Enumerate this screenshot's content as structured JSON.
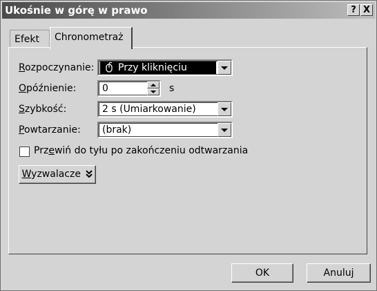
{
  "window": {
    "title": "Ukośnie w górę w prawo",
    "help_label": "?",
    "close_label": "X"
  },
  "tabs": [
    {
      "label": "Efekt"
    },
    {
      "label": "Chronometraż"
    }
  ],
  "fields": {
    "start": {
      "label_u": "R",
      "label_rest": "ozpoczynanie:",
      "value": "Przy kliknięciu",
      "icon": "mouse-icon"
    },
    "delay": {
      "label_u": "O",
      "label_rest": "późnienie:",
      "value": "0",
      "unit": "s"
    },
    "speed": {
      "label_u": "S",
      "label_rest": "zybkość:",
      "value": "2 s (Umiarkowanie)"
    },
    "repeat": {
      "label_u": "P",
      "label_rest": "owtarzanie:",
      "value": "(brak)"
    }
  },
  "rewind": {
    "label_pre": "Prz",
    "label_u": "e",
    "label_post": "wiń do tyłu po zakończeniu odtwarzania",
    "checked": false
  },
  "triggers_button": {
    "label_u": "W",
    "label_rest": "yzwalacze",
    "icon": "double-chevron-down-icon"
  },
  "footer": {
    "ok_label": "OK",
    "cancel_label": "Anuluj"
  }
}
